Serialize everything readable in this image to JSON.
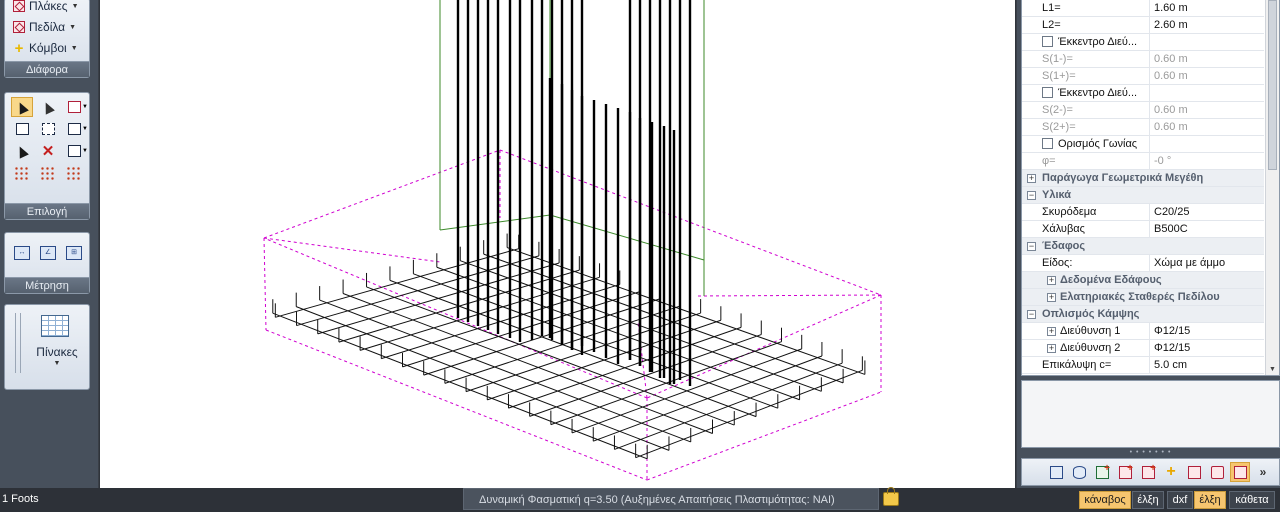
{
  "left_ribbon": {
    "top_menu": [
      {
        "label": "Πλάκες",
        "icon": "slab-icon"
      },
      {
        "label": "Πεδίλα",
        "icon": "footing-icon"
      },
      {
        "label": "Κόμβοι",
        "icon": "node-plus-icon"
      }
    ],
    "groups": {
      "misc": "Διάφορα",
      "selection": "Επιλογή",
      "measurement": "Μέτρηση",
      "tables": "Πίνακες"
    }
  },
  "properties": {
    "rows": [
      {
        "kind": "value",
        "name": "L1=",
        "value": "1.60 m",
        "dim": false
      },
      {
        "kind": "value",
        "name": "L2=",
        "value": "2.60 m",
        "dim": false
      },
      {
        "kind": "check",
        "name": "Έκκεντρο Διεύ...",
        "value": "",
        "dim": false
      },
      {
        "kind": "value",
        "name": "S(1-)=",
        "value": "0.60 m",
        "dim": true
      },
      {
        "kind": "value",
        "name": "S(1+)=",
        "value": "0.60 m",
        "dim": true
      },
      {
        "kind": "check",
        "name": "Έκκεντρο Διεύ...",
        "value": "",
        "dim": false
      },
      {
        "kind": "value",
        "name": "S(2-)=",
        "value": "0.60 m",
        "dim": true
      },
      {
        "kind": "value",
        "name": "S(2+)=",
        "value": "0.60 m",
        "dim": true
      },
      {
        "kind": "check",
        "name": "Ορισμός Γωνίας",
        "value": "",
        "dim": false
      },
      {
        "kind": "value",
        "name": "φ=",
        "value": "-0 °",
        "dim": true
      },
      {
        "kind": "category",
        "name": "Παράγωγα Γεωμετρικά Μεγέθη",
        "sign": "+"
      },
      {
        "kind": "category",
        "name": "Υλικά",
        "sign": "−"
      },
      {
        "kind": "value",
        "name": "Σκυρόδεμα",
        "value": "C20/25",
        "dim": false
      },
      {
        "kind": "value",
        "name": "Χάλυβας",
        "value": "B500C",
        "dim": false
      },
      {
        "kind": "category",
        "name": "Έδαφος",
        "sign": "−"
      },
      {
        "kind": "value",
        "name": "Είδος:",
        "value": "Χώμα με άμμο",
        "dim": false
      },
      {
        "kind": "subcategory",
        "name": "Δεδομένα Εδάφους",
        "sign": "+"
      },
      {
        "kind": "subcategory",
        "name": "Ελατηριακές Σταθερές Πεδίλου",
        "sign": "+"
      },
      {
        "kind": "category",
        "name": "Οπλισμός Κάμψης",
        "sign": "−"
      },
      {
        "kind": "subvalue",
        "name": "Διεύθυνση 1",
        "value": "Φ12/15",
        "sign": "+"
      },
      {
        "kind": "subvalue",
        "name": "Διεύθυνση 2",
        "value": "Φ12/15",
        "sign": "+"
      },
      {
        "kind": "value",
        "name": "Επικάλυψη c=",
        "value": "5.0 cm",
        "dim": false
      }
    ]
  },
  "statusbar": {
    "left": "1 Foots",
    "analysis": "Δυναμική Φασματική q=3.50 (Αυξημένες Απαιτήσεις Πλαστιμότητας: ΝΑΙ)",
    "buttons": [
      {
        "label": "κάναβος",
        "on": true
      },
      {
        "label": "έλξη",
        "on": false
      },
      {
        "label": "dxf",
        "on": false
      },
      {
        "label": "έλξη",
        "on": true
      },
      {
        "label": "κάθετα",
        "on": false
      }
    ]
  },
  "colors": {
    "accent": "#f6c56f",
    "outline": "#d000d0",
    "column": "#3c8a2a",
    "rebar": "#000000"
  }
}
